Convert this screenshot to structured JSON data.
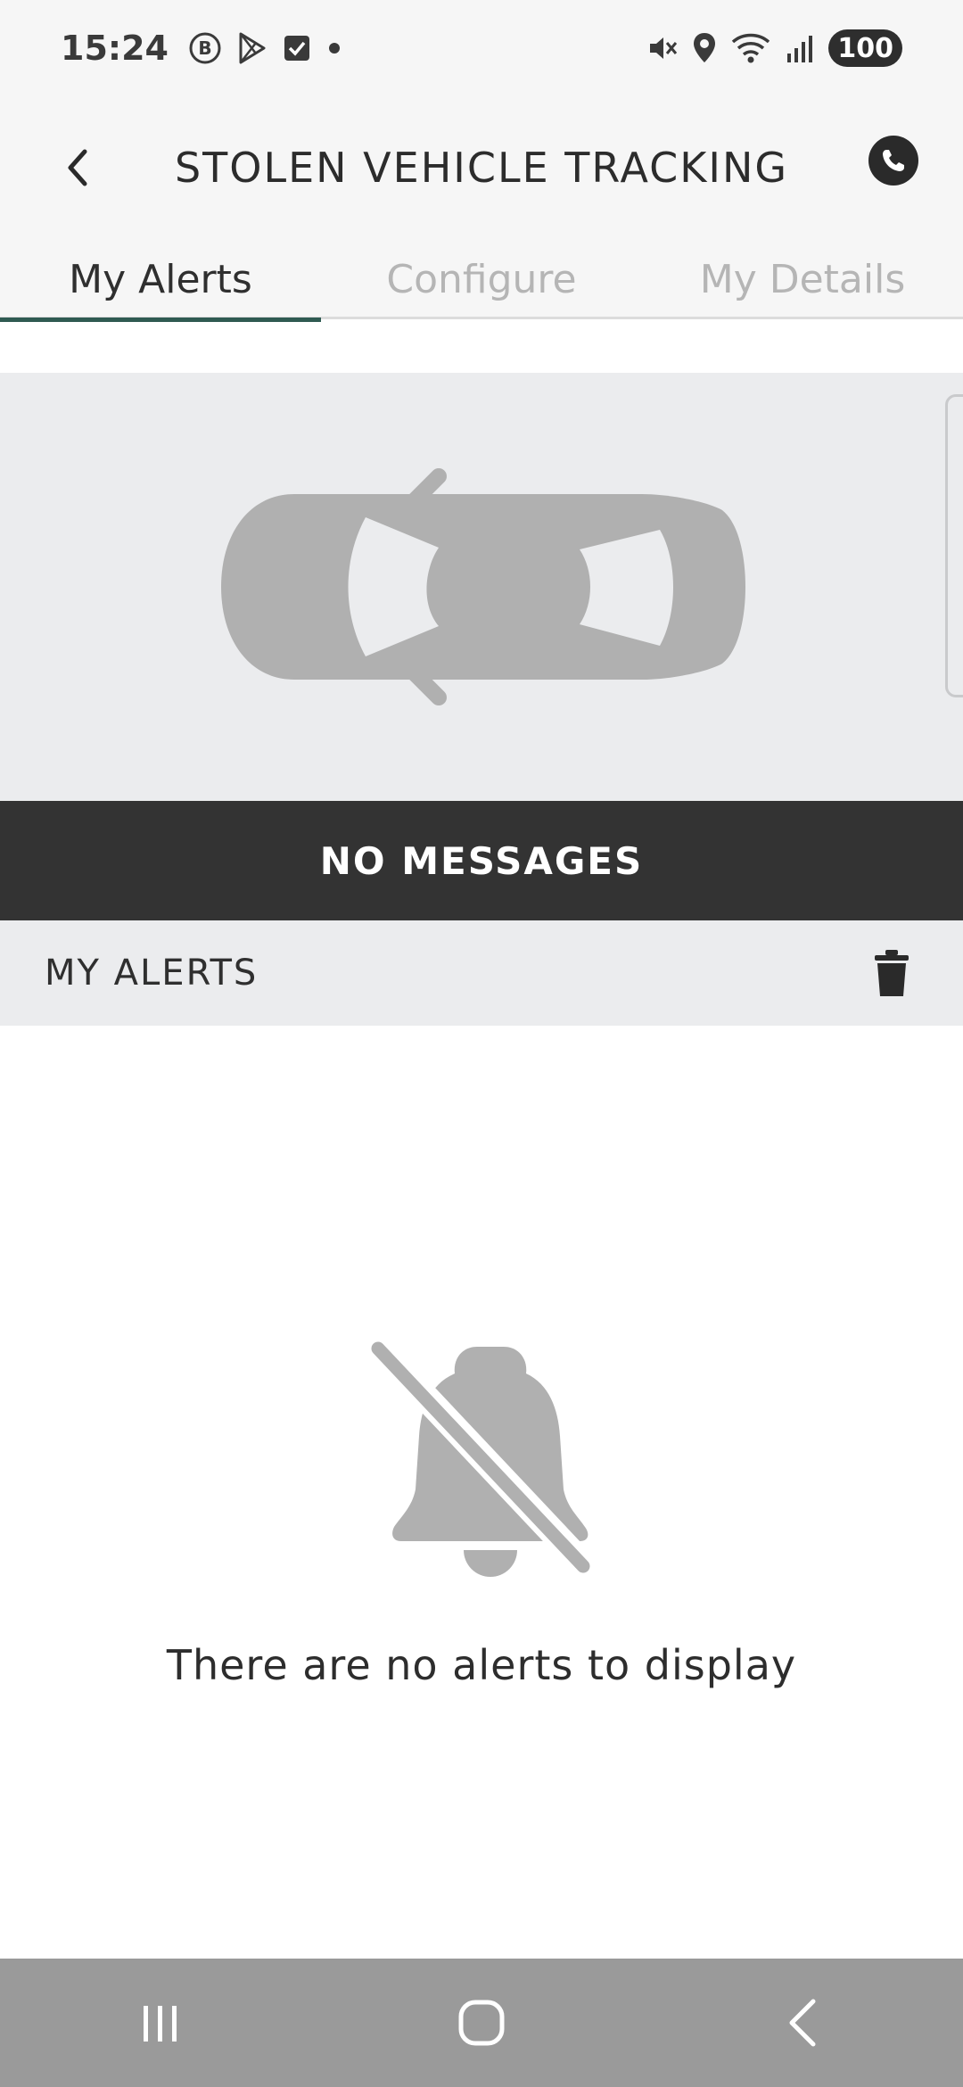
{
  "status_bar": {
    "time": "15:24",
    "battery": "100",
    "left_icons": [
      "bentley-b-icon",
      "play-store-icon",
      "checkbox-icon",
      "dot-icon"
    ],
    "right_icons": [
      "mute-icon",
      "location-icon",
      "wifi-icon",
      "signal-icon"
    ]
  },
  "header": {
    "title": "STOLEN VEHICLE TRACKING",
    "back_icon": "chevron-left-icon",
    "call_icon": "phone-icon"
  },
  "tabs": [
    {
      "label": "My Alerts",
      "active": true
    },
    {
      "label": "Configure",
      "active": false
    },
    {
      "label": "My Details",
      "active": false
    }
  ],
  "banner": {
    "label": "NO MESSAGES"
  },
  "alerts_section": {
    "title": "MY ALERTS",
    "delete_icon": "trash-icon"
  },
  "empty_state": {
    "icon": "bell-off-icon",
    "message": "There are no alerts to display"
  },
  "nav_bar": {
    "buttons": [
      "recent-apps-icon",
      "home-icon",
      "back-icon"
    ]
  },
  "colors": {
    "tab_active_underline": "#2f5a52",
    "banner_bg": "#333333",
    "car_bg": "#ebecee",
    "icon_gray": "#b0b0b0"
  }
}
